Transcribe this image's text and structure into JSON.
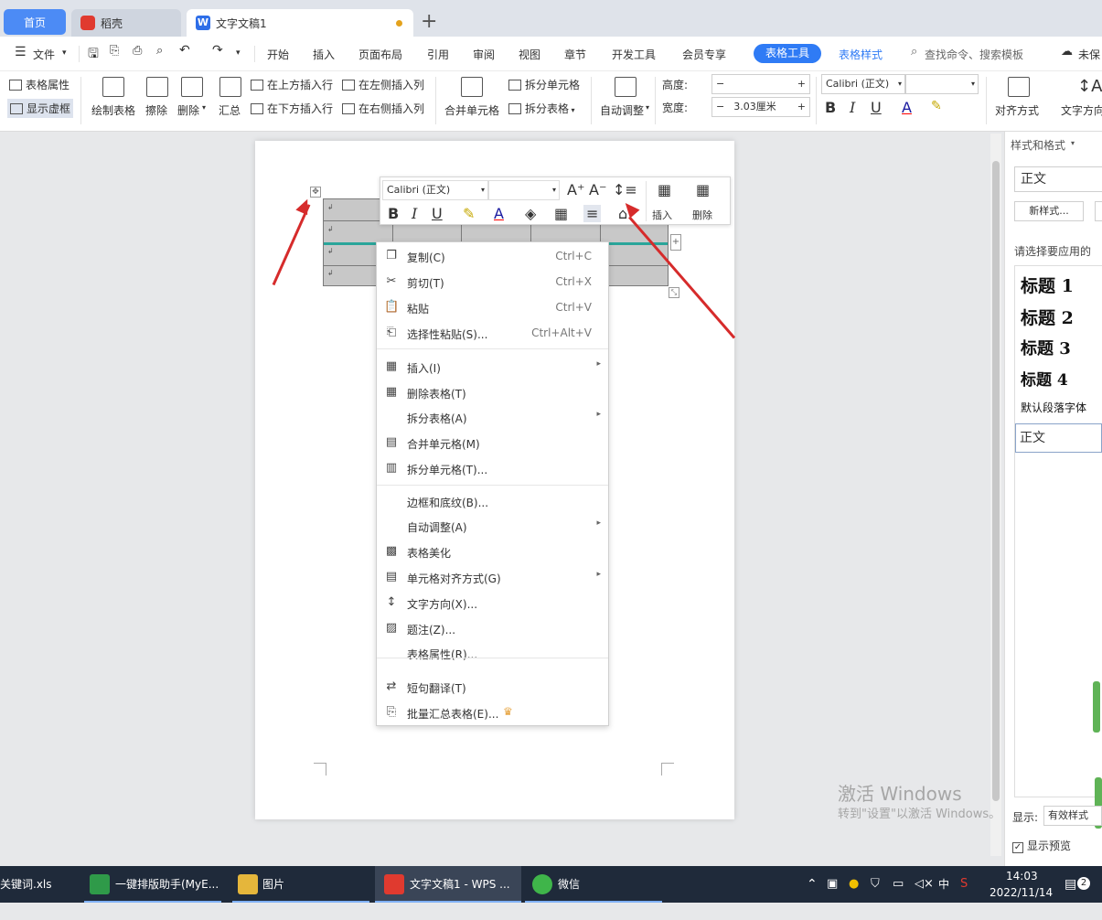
{
  "tabs": {
    "home": "首页",
    "daoke": "稻壳",
    "doc": "文字文稿1",
    "plus": "+"
  },
  "menubar": {
    "file": "文件",
    "items": [
      "开始",
      "插入",
      "页面布局",
      "引用",
      "审阅",
      "视图",
      "章节",
      "开发工具",
      "会员专享"
    ],
    "tabletool": "表格工具",
    "tablestyle": "表格样式",
    "search": "查找命令、搜索模板",
    "save": "未保"
  },
  "ribbon": {
    "table_props": "表格属性",
    "show_grid": "显示虚框",
    "draw_table": "绘制表格",
    "erase": "擦除",
    "delete": "删除",
    "summary": "汇总",
    "insert_above": "在上方插入行",
    "insert_below": "在下方插入行",
    "insert_left": "在左侧插入列",
    "insert_right": "在右侧插入列",
    "merge": "合并单元格",
    "split_cell": "拆分单元格",
    "split_table": "拆分表格",
    "autofit": "自动调整",
    "height_label": "高度:",
    "width_label": "宽度:",
    "width_value": "3.03厘米",
    "font": "Calibri (正文)",
    "align": "对齐方式",
    "text_dir": "文字方向"
  },
  "minitoolbar": {
    "font": "Calibri (正文)",
    "insert": "插入",
    "delete": "删除"
  },
  "context_menu": [
    {
      "icon": "copy-icon",
      "label": "复制(C)",
      "shortcut": "Ctrl+C"
    },
    {
      "icon": "cut-icon",
      "label": "剪切(T)",
      "shortcut": "Ctrl+X"
    },
    {
      "icon": "paste-icon",
      "label": "粘贴",
      "shortcut": "Ctrl+V"
    },
    {
      "icon": "paste-special-icon",
      "label": "选择性粘贴(S)...",
      "shortcut": "Ctrl+Alt+V"
    },
    {
      "icon": "table-insert-icon",
      "label": "插入(I)",
      "sub": true
    },
    {
      "icon": "table-delete-icon",
      "label": "删除表格(T)"
    },
    {
      "icon": "",
      "label": "拆分表格(A)",
      "sub": true
    },
    {
      "icon": "merge-cells-icon",
      "label": "合并单元格(M)"
    },
    {
      "icon": "split-cells-icon",
      "label": "拆分单元格(T)..."
    },
    {
      "icon": "",
      "label": "边框和底纹(B)..."
    },
    {
      "icon": "",
      "label": "自动调整(A)",
      "sub": true
    },
    {
      "icon": "table-beautify-icon",
      "label": "表格美化"
    },
    {
      "icon": "cell-align-icon",
      "label": "单元格对齐方式(G)",
      "sub": true
    },
    {
      "icon": "text-direction-icon",
      "label": "文字方向(X)..."
    },
    {
      "icon": "caption-icon",
      "label": "题注(Z)..."
    },
    {
      "icon": "",
      "label": "表格属性(R)..."
    },
    {
      "icon": "translate-icon",
      "label": "短句翻译(T)"
    },
    {
      "icon": "batch-summary-icon",
      "label": "批量汇总表格(E)..."
    }
  ],
  "right_panel": {
    "title": "样式和格式",
    "current": "正文",
    "new_style": "新样式...",
    "prompt": "请选择要应用的",
    "styles": [
      "标题 1",
      "标题 2",
      "标题 3",
      "标题 4"
    ],
    "default_font": "默认段落字体",
    "body": "正文",
    "show_label": "显示:",
    "show_value": "有效样式",
    "preview": "显示预览"
  },
  "watermark": {
    "line1": "激活 Windows",
    "line2": "转到\"设置\"以激活 Windows。"
  },
  "taskbar": {
    "items": [
      "关键词.xls",
      "一键排版助手(MyE...",
      "图片",
      "文字文稿1 - WPS ...",
      "微信"
    ],
    "time": "14:03",
    "date": "2022/11/14",
    "ime": "中",
    "badge": "2"
  }
}
